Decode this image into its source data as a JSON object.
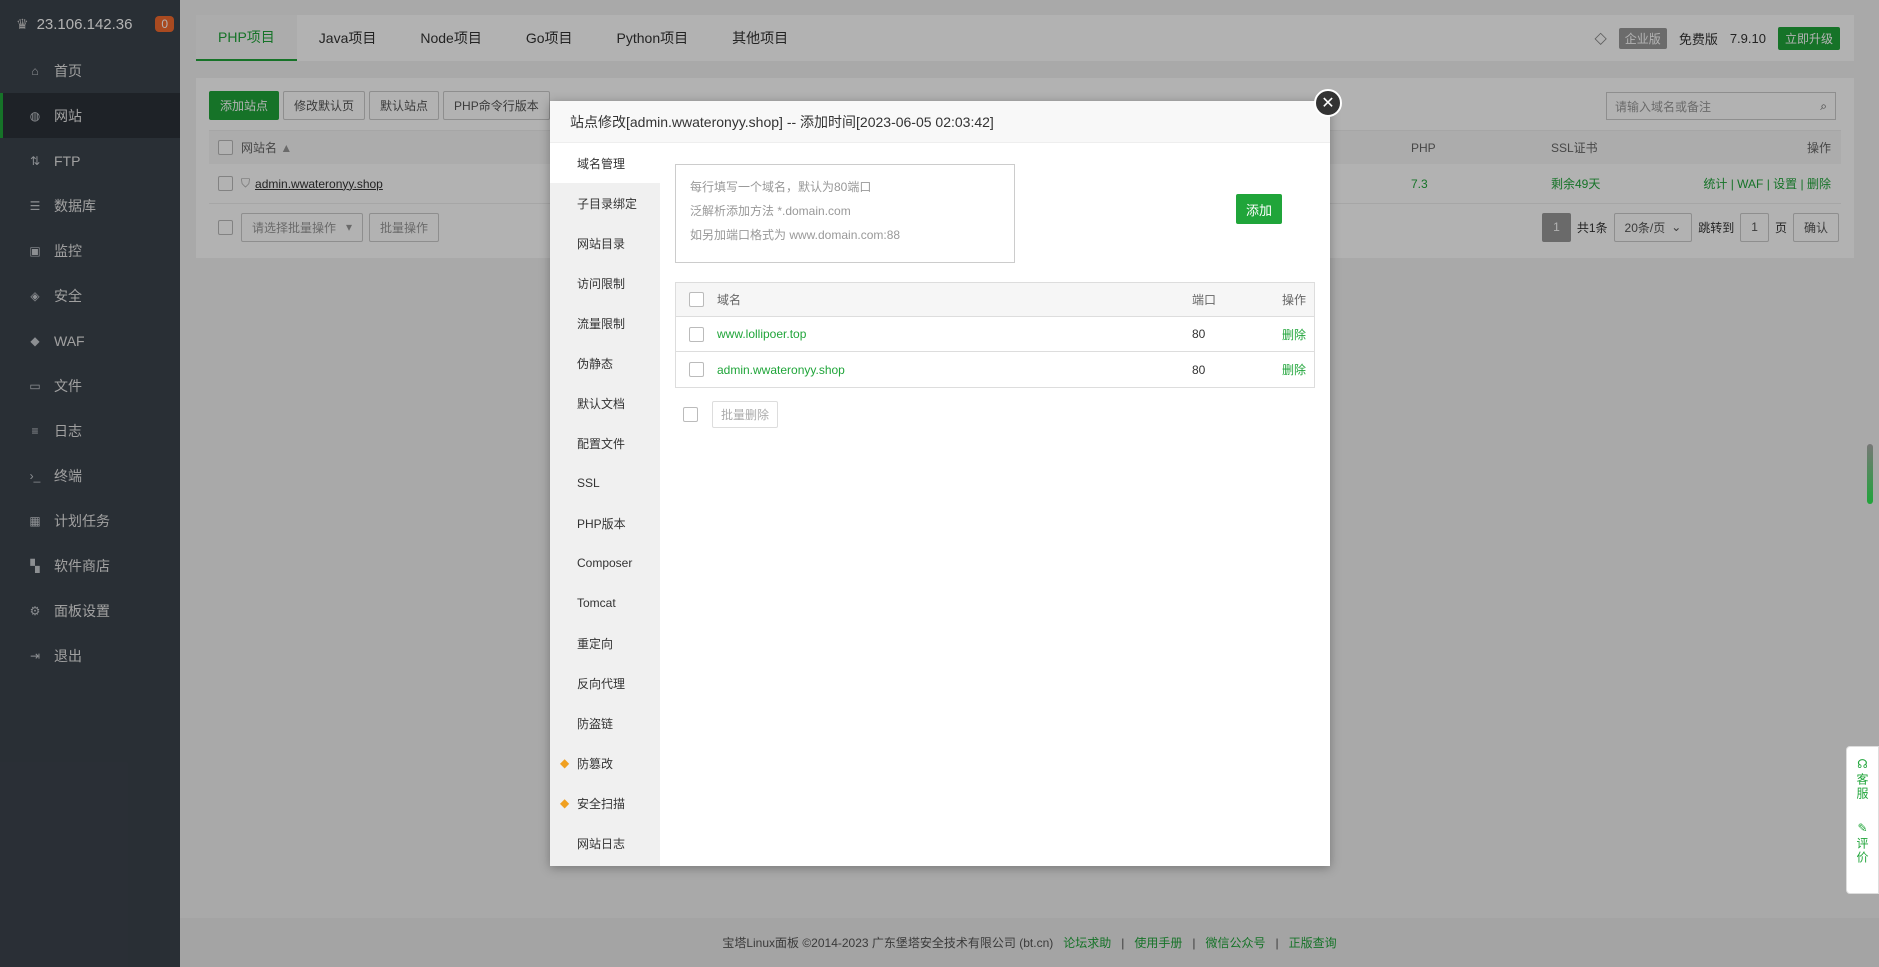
{
  "sidebar": {
    "ip": "23.106.142.36",
    "badge": "0",
    "items": [
      {
        "label": "首页",
        "icon": "home-icon",
        "glyph": "⌂"
      },
      {
        "label": "网站",
        "icon": "globe-icon",
        "glyph": "◍"
      },
      {
        "label": "FTP",
        "icon": "ftp-icon",
        "glyph": "⇅"
      },
      {
        "label": "数据库",
        "icon": "database-icon",
        "glyph": "☰"
      },
      {
        "label": "监控",
        "icon": "monitor-icon",
        "glyph": "▣"
      },
      {
        "label": "安全",
        "icon": "shield-icon",
        "glyph": "◈"
      },
      {
        "label": "WAF",
        "icon": "waf-shield-icon",
        "glyph": "◆"
      },
      {
        "label": "文件",
        "icon": "folder-icon",
        "glyph": "▭"
      },
      {
        "label": "日志",
        "icon": "log-icon",
        "glyph": "≡"
      },
      {
        "label": "终端",
        "icon": "terminal-icon",
        "glyph": "›_"
      },
      {
        "label": "计划任务",
        "icon": "calendar-icon",
        "glyph": "▦"
      },
      {
        "label": "软件商店",
        "icon": "apps-icon",
        "glyph": "▚"
      },
      {
        "label": "面板设置",
        "icon": "gear-icon",
        "glyph": "⚙"
      },
      {
        "label": "退出",
        "icon": "logout-icon",
        "glyph": "⇥"
      }
    ]
  },
  "topbar": {
    "tabs": [
      "PHP项目",
      "Java项目",
      "Node项目",
      "Go项目",
      "Python项目",
      "其他项目"
    ],
    "enterprise": "企业版",
    "free": "免费版",
    "version": "7.9.10",
    "upgrade": "立即升级"
  },
  "site_panel": {
    "toolbar": [
      "添加站点",
      "修改默认页",
      "默认站点",
      "PHP命令行版本"
    ],
    "search_placeholder": "请输入域名或备注",
    "headers": {
      "name": "网站名",
      "php": "PHP",
      "ssl": "SSL证书",
      "ops": "操作"
    },
    "row": {
      "name": "admin.wwateronyy.shop",
      "php": "7.3",
      "ssl": "剩余49天",
      "ops": [
        "统计",
        "WAF",
        "设置",
        "删除"
      ]
    },
    "batch_select": "请选择批量操作",
    "batch_btn": "批量操作",
    "pagination": {
      "page": "1",
      "total": "共1条",
      "per_page": "20条/页",
      "jump_label": "跳转到",
      "jump_value": "1",
      "page_unit": "页",
      "confirm": "确认"
    }
  },
  "footer": {
    "copyright": "宝塔Linux面板 ©2014-2023 广东堡塔安全技术有限公司 (bt.cn)",
    "links": [
      "论坛求助",
      "使用手册",
      "微信公众号",
      "正版查询"
    ]
  },
  "modal": {
    "title": "站点修改[admin.wwateronyy.shop] -- 添加时间[2023-06-05 02:03:42]",
    "side_items": [
      {
        "label": "域名管理",
        "gem": false
      },
      {
        "label": "子目录绑定",
        "gem": false
      },
      {
        "label": "网站目录",
        "gem": false
      },
      {
        "label": "访问限制",
        "gem": false
      },
      {
        "label": "流量限制",
        "gem": false
      },
      {
        "label": "伪静态",
        "gem": false
      },
      {
        "label": "默认文档",
        "gem": false
      },
      {
        "label": "配置文件",
        "gem": false
      },
      {
        "label": "SSL",
        "gem": false
      },
      {
        "label": "PHP版本",
        "gem": false
      },
      {
        "label": "Composer",
        "gem": false
      },
      {
        "label": "Tomcat",
        "gem": false
      },
      {
        "label": "重定向",
        "gem": false
      },
      {
        "label": "反向代理",
        "gem": false
      },
      {
        "label": "防盗链",
        "gem": false
      },
      {
        "label": "防篡改",
        "gem": true
      },
      {
        "label": "安全扫描",
        "gem": true
      },
      {
        "label": "网站日志",
        "gem": false
      }
    ],
    "placeholder_lines": [
      "每行填写一个域名，默认为80端口",
      "泛解析添加方法 *.domain.com",
      "如另加端口格式为 www.domain.com:88"
    ],
    "add_btn": "添加",
    "table": {
      "headers": {
        "domain": "域名",
        "port": "端口",
        "op": "操作"
      },
      "rows": [
        {
          "domain": "www.lollipoer.top",
          "port": "80",
          "op": "删除"
        },
        {
          "domain": "admin.wwateronyy.shop",
          "port": "80",
          "op": "删除"
        }
      ]
    },
    "batch_delete": "批量删除"
  },
  "float_tools": {
    "service": "客服",
    "review": "评价"
  },
  "colors": {
    "accent": "#20a53a",
    "sidebar": "#3c444d",
    "badge": "#f26a2e"
  }
}
